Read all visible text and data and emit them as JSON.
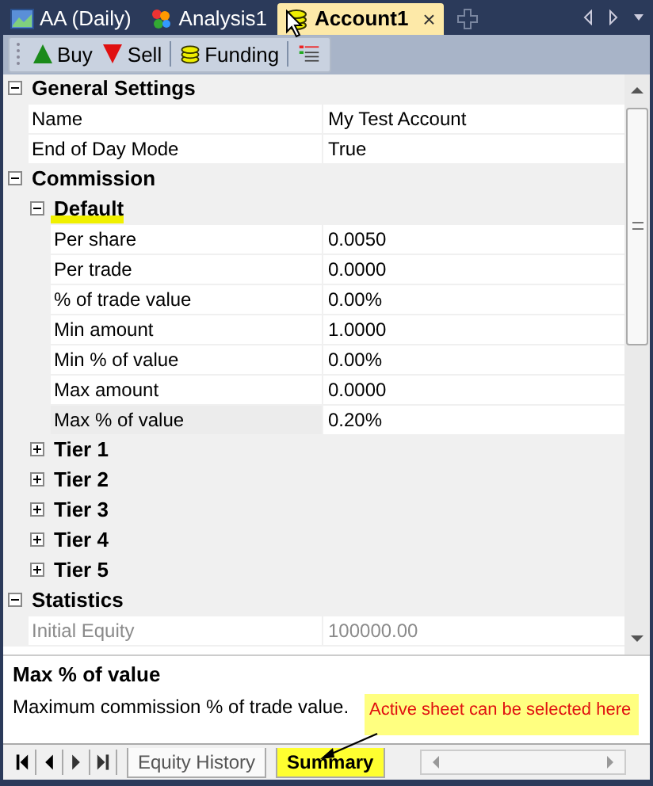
{
  "doc_tabs": [
    {
      "label": "AA (Daily)",
      "selected": false
    },
    {
      "label": "Analysis1",
      "selected": false
    },
    {
      "label": "Account1",
      "selected": true,
      "close": "×"
    }
  ],
  "toolbar": [
    {
      "label": "Buy"
    },
    {
      "label": "Sell"
    },
    {
      "label": "Funding"
    }
  ],
  "grid": [
    {
      "label": "General Settings",
      "expanded": true,
      "children": [
        {
          "kind": "property",
          "label": "Name",
          "value": "My Test Account",
          "disabled": false,
          "selected": false
        },
        {
          "kind": "property",
          "label": "End of Day Mode",
          "value": "True",
          "disabled": false,
          "selected": false
        }
      ]
    },
    {
      "label": "Commission",
      "expanded": true,
      "children": [
        {
          "kind": "category",
          "label": "Default",
          "expanded": true,
          "highlighted": true,
          "children": [
            {
              "kind": "property",
              "label": "Per share",
              "value": "0.0050",
              "disabled": false,
              "selected": false
            },
            {
              "kind": "property",
              "label": "Per trade",
              "value": "0.0000",
              "disabled": false,
              "selected": false
            },
            {
              "kind": "property",
              "label": "% of trade value",
              "value": "0.00%",
              "disabled": false,
              "selected": false
            },
            {
              "kind": "property",
              "label": "Min amount",
              "value": "1.0000",
              "disabled": false,
              "selected": false
            },
            {
              "kind": "property",
              "label": "Min % of value",
              "value": "0.00%",
              "disabled": false,
              "selected": false
            },
            {
              "kind": "property",
              "label": "Max amount",
              "value": "0.0000",
              "disabled": false,
              "selected": false
            },
            {
              "kind": "property",
              "label": "Max % of value",
              "value": "0.20%",
              "disabled": false,
              "selected": true
            }
          ]
        },
        {
          "kind": "category",
          "label": "Tier 1",
          "expanded": false,
          "highlighted": false
        },
        {
          "kind": "category",
          "label": "Tier 2",
          "expanded": false,
          "highlighted": false
        },
        {
          "kind": "category",
          "label": "Tier 3",
          "expanded": false,
          "highlighted": false
        },
        {
          "kind": "category",
          "label": "Tier 4",
          "expanded": false,
          "highlighted": false
        },
        {
          "kind": "category",
          "label": "Tier 5",
          "expanded": false,
          "highlighted": false
        }
      ]
    },
    {
      "label": "Statistics",
      "expanded": true,
      "children": [
        {
          "kind": "property",
          "label": "Initial Equity",
          "value": "100000.00",
          "disabled": true,
          "selected": false
        }
      ]
    }
  ],
  "description": {
    "title": "Max % of value",
    "text": "Maximum commission % of trade value."
  },
  "sheet_tabs": [
    {
      "label": "Equity History",
      "selected": false
    },
    {
      "label": "Summary",
      "selected": true
    }
  ],
  "callout": {
    "text": "Active sheet can be selected here"
  }
}
